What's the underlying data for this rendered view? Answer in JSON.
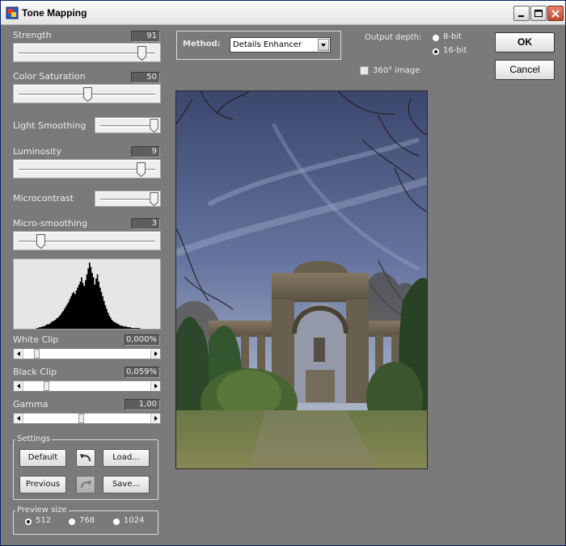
{
  "window": {
    "title": "Tone Mapping"
  },
  "adjustments": {
    "strength": {
      "label": "Strength",
      "value": "91",
      "level": 0.91
    },
    "color_saturation": {
      "label": "Color Saturation",
      "value": "50",
      "level": 0.5
    },
    "light_smoothing": {
      "label": "Light Smoothing",
      "level": 1.0
    },
    "luminosity": {
      "label": "Luminosity",
      "value": "9",
      "level": 0.9
    },
    "microcontrast": {
      "label": "Microcontrast",
      "level": 1.0
    },
    "micro_smoothing": {
      "label": "Micro-smoothing",
      "value": "3",
      "level": 0.15
    }
  },
  "histogram": {
    "bins": [
      0,
      0,
      0,
      0,
      0,
      0,
      0,
      0,
      0,
      0,
      0,
      0,
      0,
      0,
      0,
      0,
      0,
      1,
      1,
      2,
      2,
      3,
      3,
      4,
      5,
      6,
      6,
      7,
      9,
      10,
      11,
      12,
      14,
      15,
      17,
      19,
      22,
      24,
      27,
      30,
      33,
      36,
      40,
      44,
      48,
      50,
      47,
      52,
      56,
      60,
      64,
      70,
      62,
      58,
      66,
      74,
      82,
      90,
      84,
      76,
      70,
      60,
      68,
      74,
      64,
      56,
      50,
      44,
      38,
      32,
      27,
      22,
      18,
      15,
      12,
      10,
      9,
      8,
      7,
      6,
      5,
      4,
      4,
      3,
      3,
      3,
      2,
      2,
      2,
      1,
      1,
      1,
      1,
      1,
      1,
      1,
      0,
      0,
      0,
      0,
      0,
      0,
      0,
      0,
      0,
      0,
      0,
      0,
      0,
      0,
      0
    ]
  },
  "white_clip": {
    "label": "White Clip",
    "value": "0,000%",
    "level": 0.08
  },
  "black_clip": {
    "label": "Black Clip",
    "value": "0,059%",
    "level": 0.16
  },
  "gamma": {
    "label": "Gamma",
    "value": "1,00",
    "level": 0.45
  },
  "settings": {
    "title": "Settings",
    "default_label": "Default",
    "load_label": "Load...",
    "previous_label": "Previous",
    "save_label": "Save...",
    "undo_icon": "undo-arrow-icon",
    "redo_icon": "redo-arrow-icon"
  },
  "preview_size": {
    "title": "Preview size",
    "options": [
      "512",
      "768",
      "1024"
    ],
    "selected": "512"
  },
  "method": {
    "label": "Method:",
    "selected": "Details Enhancer"
  },
  "output_depth": {
    "label": "Output depth:",
    "options": [
      "8-bit",
      "16-bit"
    ],
    "selected": "16-bit"
  },
  "image360": {
    "label": "360° image",
    "checked": false
  },
  "actions": {
    "ok_label": "OK",
    "cancel_label": "Cancel"
  },
  "colors": {
    "panel": "#7a7a7a",
    "title_bar": "#f0f0f0",
    "histogram_bg": "#e6e6e6"
  }
}
